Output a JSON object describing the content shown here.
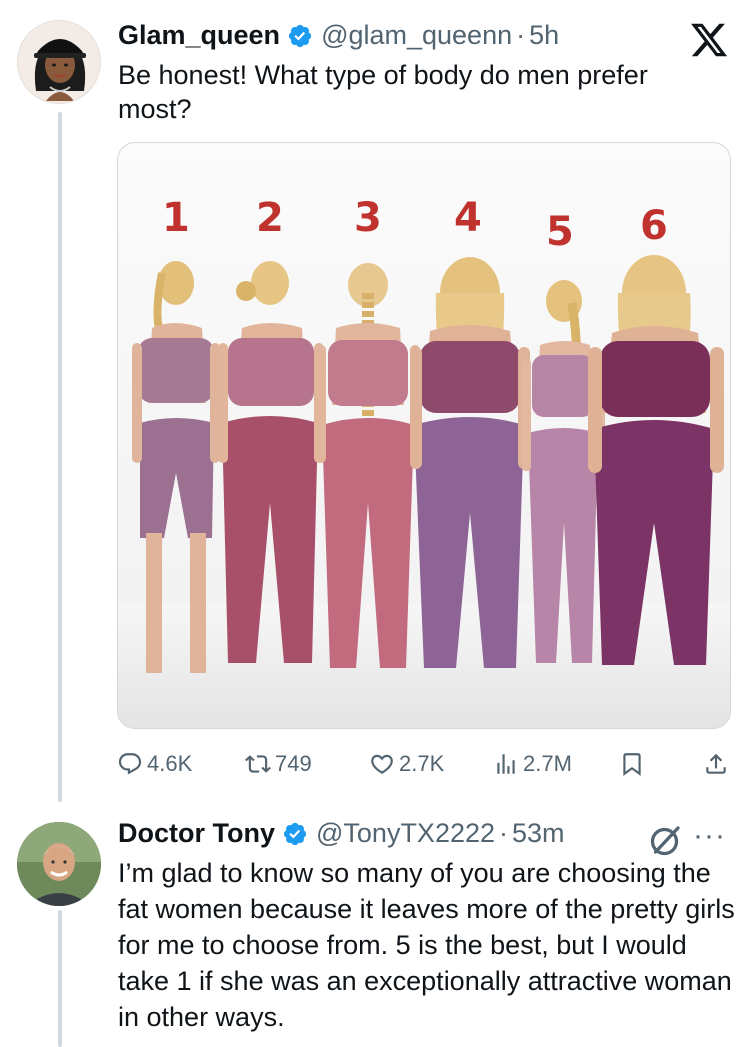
{
  "tweet": {
    "author_name": "Glam_queen",
    "handle": "@glam_queenn",
    "separator": "·",
    "time": "5h",
    "text": "Be honest! What type of body do men prefer most?",
    "image_labels": [
      "1",
      "2",
      "3",
      "4",
      "5",
      "6"
    ],
    "stats": {
      "replies": "4.6K",
      "reposts": "749",
      "likes": "2.7K",
      "views": "2.7M"
    }
  },
  "reply": {
    "author_name": "Doctor Tony",
    "handle": "@TonyTX2222",
    "separator": "·",
    "time": "53m",
    "text": "I’m glad to know so many of you are choosing the fat women because it leaves more of the pretty girls for me to choose from. 5 is the best, but I would take 1 if she was an exceptionally attractive woman in other ways."
  },
  "colors": {
    "verified": "#1d9bf0",
    "text_primary": "#0f1419",
    "text_secondary": "#536471",
    "number_labels": "#c0322e"
  },
  "icons": [
    "x-logo-icon",
    "verified-badge-icon",
    "reply-icon",
    "repost-icon",
    "like-icon",
    "views-icon",
    "bookmark-icon",
    "share-icon",
    "grok-icon",
    "more-icon"
  ]
}
